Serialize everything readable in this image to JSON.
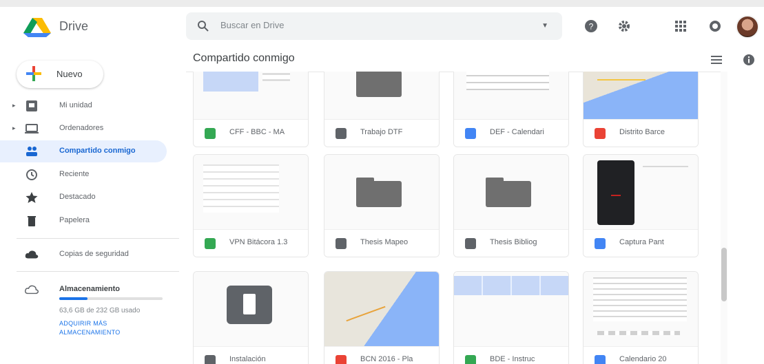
{
  "app": {
    "name": "Drive"
  },
  "search": {
    "placeholder": "Buscar en Drive"
  },
  "header_icons": [
    "help-icon",
    "settings-icon",
    "apps-grid-icon",
    "notifications-icon"
  ],
  "sidebar": {
    "new_label": "Nuevo",
    "items": [
      {
        "label": "Mi unidad",
        "icon": "my-drive-icon",
        "expandable": true
      },
      {
        "label": "Ordenadores",
        "icon": "computers-icon",
        "expandable": true
      },
      {
        "label": "Compartido conmigo",
        "icon": "shared-icon",
        "active": true
      },
      {
        "label": "Reciente",
        "icon": "clock-icon"
      },
      {
        "label": "Destacado",
        "icon": "star-icon"
      },
      {
        "label": "Papelera",
        "icon": "trash-icon"
      },
      {
        "label": "Copias de seguridad",
        "icon": "cloud-icon"
      }
    ],
    "storage": {
      "label": "Almacenamiento",
      "used_text": "63,6 GB de 232 GB usado",
      "fraction_used": 0.27,
      "buy_link": "ADQUIRIR MÁS ALMACENAMIENTO"
    }
  },
  "main": {
    "title": "Compartido conmigo",
    "files": [
      {
        "name": "CFF - BBC - MA",
        "type": "sheet",
        "thumb": "sheet"
      },
      {
        "name": "Trabajo DTF",
        "type": "folder",
        "thumb": "folder"
      },
      {
        "name": "DEF - Calendari",
        "type": "doc",
        "thumb": "doc"
      },
      {
        "name": "Distrito Barce",
        "type": "map",
        "thumb": "map"
      },
      {
        "name": "VPN Bitácora 1.3",
        "type": "sheet",
        "thumb": "sheetsmall"
      },
      {
        "name": "Thesis Mapeo",
        "type": "folder",
        "thumb": "folder"
      },
      {
        "name": "Thesis Bibliog",
        "type": "folder",
        "thumb": "folder"
      },
      {
        "name": "Captura Pant",
        "type": "doc",
        "thumb": "phone"
      },
      {
        "name": "Instalación",
        "type": "other",
        "thumb": "trashbox"
      },
      {
        "name": "BCN 2016 - Pla",
        "type": "map",
        "thumb": "map2"
      },
      {
        "name": "BDE - Instruc",
        "type": "sheet",
        "thumb": "sheetwide"
      },
      {
        "name": "Calendario 20",
        "type": "doc",
        "thumb": "doclines"
      }
    ]
  },
  "colors": {
    "accent": "#1a73e8",
    "active_bg": "#e8f0fe",
    "sheet": "#34a853",
    "doc": "#4285f4",
    "map": "#ea4335",
    "folder": "#5f6368"
  }
}
